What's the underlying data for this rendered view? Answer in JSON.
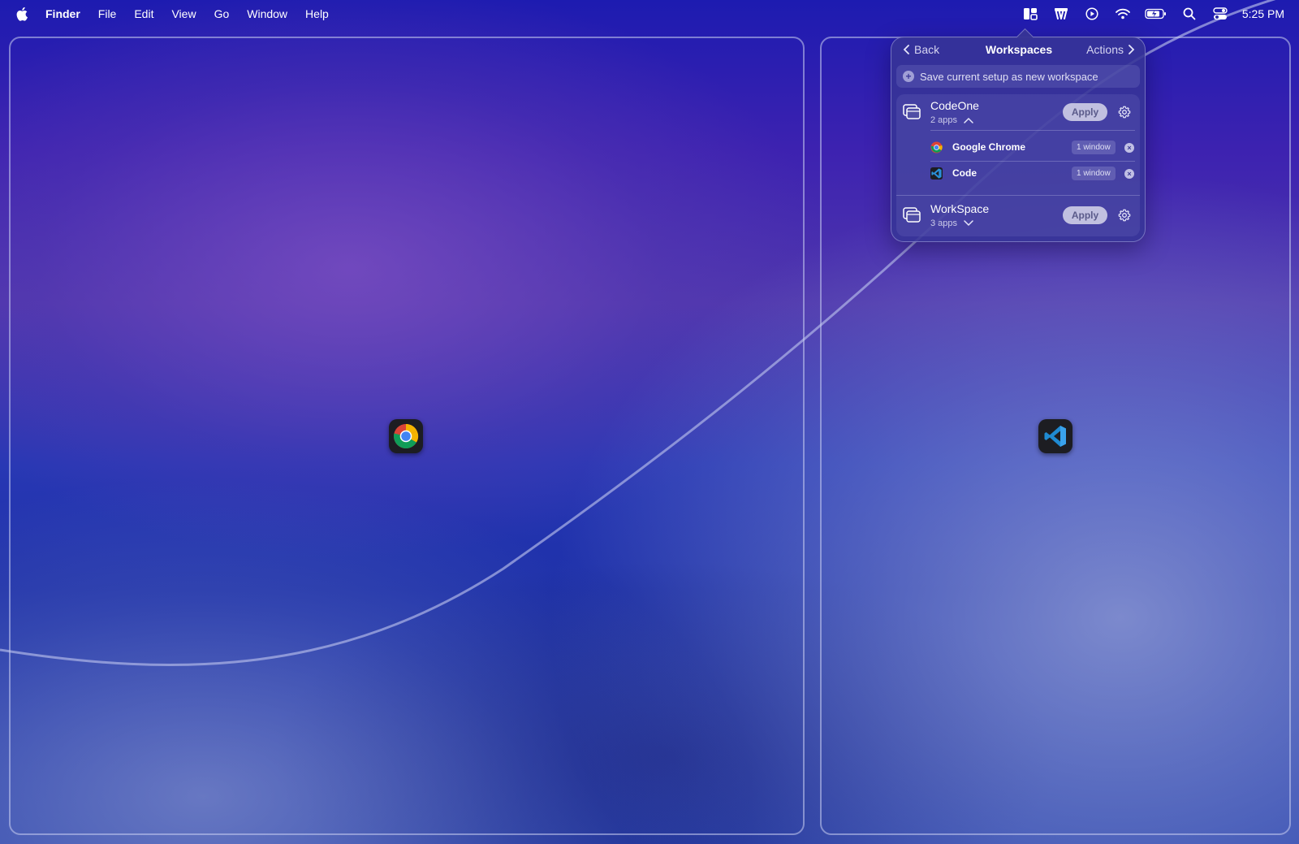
{
  "menubar": {
    "app_name": "Finder",
    "items": [
      "File",
      "Edit",
      "View",
      "Go",
      "Window",
      "Help"
    ],
    "clock": "5:25 PM"
  },
  "status_icons": [
    "workspaces-icon",
    "extension-icon",
    "play-icon",
    "wifi-icon",
    "battery-icon",
    "search-icon",
    "control-center-icon"
  ],
  "popover": {
    "back_label": "Back",
    "title": "Workspaces",
    "actions_label": "Actions",
    "save_label": "Save current setup as new workspace",
    "workspaces": [
      {
        "name": "CodeOne",
        "count": "2 apps",
        "apply_label": "Apply",
        "expanded": true,
        "apps": [
          {
            "name": "Google Chrome",
            "windows": "1 window"
          },
          {
            "name": "Code",
            "windows": "1 window"
          }
        ]
      },
      {
        "name": "WorkSpace",
        "count": "3 apps",
        "apply_label": "Apply",
        "expanded": false
      }
    ]
  },
  "desktop_apps": [
    "chrome-icon",
    "vscode-icon"
  ],
  "colors": {
    "accent": "#3c3a9a",
    "popover_bg": "#37349a"
  }
}
